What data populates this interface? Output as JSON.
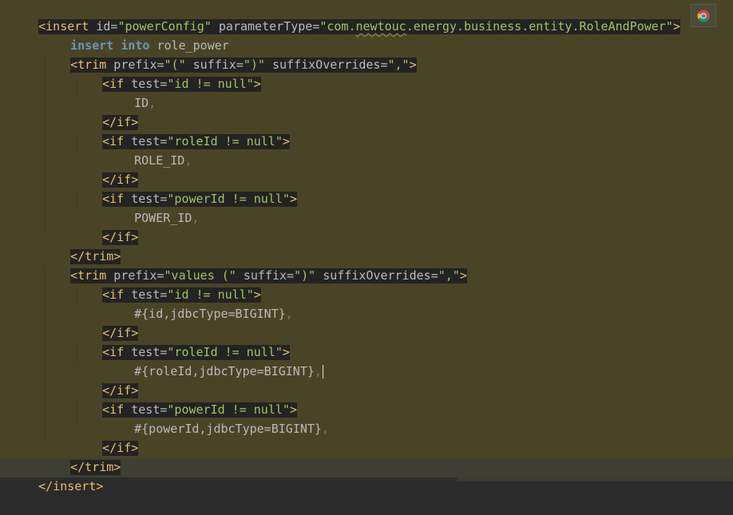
{
  "colors": {
    "editor_background": "#4a4427",
    "tag_highlight": "#232323",
    "tag": "#e8bf6a",
    "attribute_value": "#a5c25c",
    "keyword": "#6897bb",
    "text": "#bababa"
  },
  "icons": {
    "browser": "chrome-icon"
  },
  "code": {
    "line1": {
      "open": "<insert",
      "attr1": " id=",
      "val1": "\"powerConfig\"",
      "attr2": " parameterType=",
      "val2a": "\"com.",
      "val2b": "newtouc",
      "val2c": ".energy.business.entity.RoleAndPower\"",
      "close": ">"
    },
    "line2": {
      "kw1": "insert",
      "kw2": "into",
      "text": " role_power"
    },
    "line3": {
      "open": "<trim",
      "attr1": " prefix=",
      "val1": "\"(\"",
      "attr2": " suffix=",
      "val2": "\")\"",
      "attr3": " suffixOverrides=",
      "val3": "\",\"",
      "close": ">"
    },
    "line4": {
      "open": "<if",
      "attr": " test=",
      "val": "\"id != null\"",
      "close": ">"
    },
    "line5": {
      "text": "ID",
      "comma": ","
    },
    "line6": {
      "tag": "</if>"
    },
    "line7": {
      "open": "<if",
      "attr": " test=",
      "val": "\"roleId != null\"",
      "close": ">"
    },
    "line8": {
      "text": "ROLE_ID",
      "comma": ","
    },
    "line9": {
      "tag": "</if>"
    },
    "line10": {
      "open": "<if",
      "attr": " test=",
      "val": "\"powerId != null\"",
      "close": ">"
    },
    "line11": {
      "text": "POWER_ID",
      "comma": ","
    },
    "line12": {
      "tag": "</if>"
    },
    "line13": {
      "tag": "</trim>"
    },
    "line14": {
      "open": "<trim",
      "attr1": " prefix=",
      "val1": "\"values (\"",
      "attr2": " suffix=",
      "val2": "\")\"",
      "attr3": " suffixOverrides=",
      "val3": "\",\"",
      "close": ">"
    },
    "line15": {
      "open": "<if",
      "attr": " test=",
      "val": "\"id != null\"",
      "close": ">"
    },
    "line16": {
      "text": "#{id,jdbcType=BIGINT}",
      "comma": ","
    },
    "line17": {
      "tag": "</if>"
    },
    "line18": {
      "open": "<if",
      "attr": " test=",
      "val": "\"roleId != null\"",
      "close": ">"
    },
    "line19": {
      "text": "#{roleId,jdbcType=BIGINT}",
      "comma": ","
    },
    "line20": {
      "tag": "</if>"
    },
    "line21": {
      "open": "<if",
      "attr": " test=",
      "val": "\"powerId != null\"",
      "close": ">"
    },
    "line22": {
      "text": "#{powerId,jdbcType=BIGINT}",
      "comma": ","
    },
    "line23": {
      "tag": "</if>"
    },
    "line24": {
      "tag": "</trim>"
    },
    "line25": {
      "tag": "</insert>"
    }
  }
}
